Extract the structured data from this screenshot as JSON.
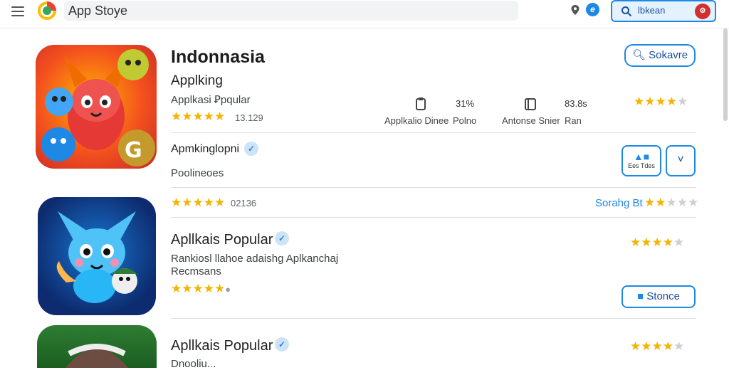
{
  "topbar": {
    "title": "App Stoye",
    "search_text": "lbkean",
    "avatar_text": "⚙"
  },
  "app1": {
    "name": "Indonnasia",
    "developer": "Applking",
    "category": "Applkasi Ꝑpqular",
    "rating_count": "13.129",
    "stat1_value": "31%",
    "stat1_label": "Applkalio Dinee",
    "stat1_label2": "Polno",
    "stat2_value": "83.8s",
    "stat2_label": "Antonse Snier",
    "stat2_label2": "Ran",
    "action_label": "Sokavre",
    "sub_title": "Apmkinglopni",
    "sub_desc": "Poolineoes",
    "thumb_text": "Ees Tdes",
    "review_count": "02136",
    "rating_link": "Sorahg Bt"
  },
  "app2": {
    "name": "Apllkais Popular",
    "description": "Rankiosl llahoe adaishg Aplkanchaj",
    "description2": "Recmsans",
    "action_label": "Stonce"
  },
  "app3": {
    "name": "Apllkais Popular",
    "description": "Dnooliu..."
  },
  "colors": {
    "accent": "#1e88e5",
    "star": "#f4b400"
  }
}
